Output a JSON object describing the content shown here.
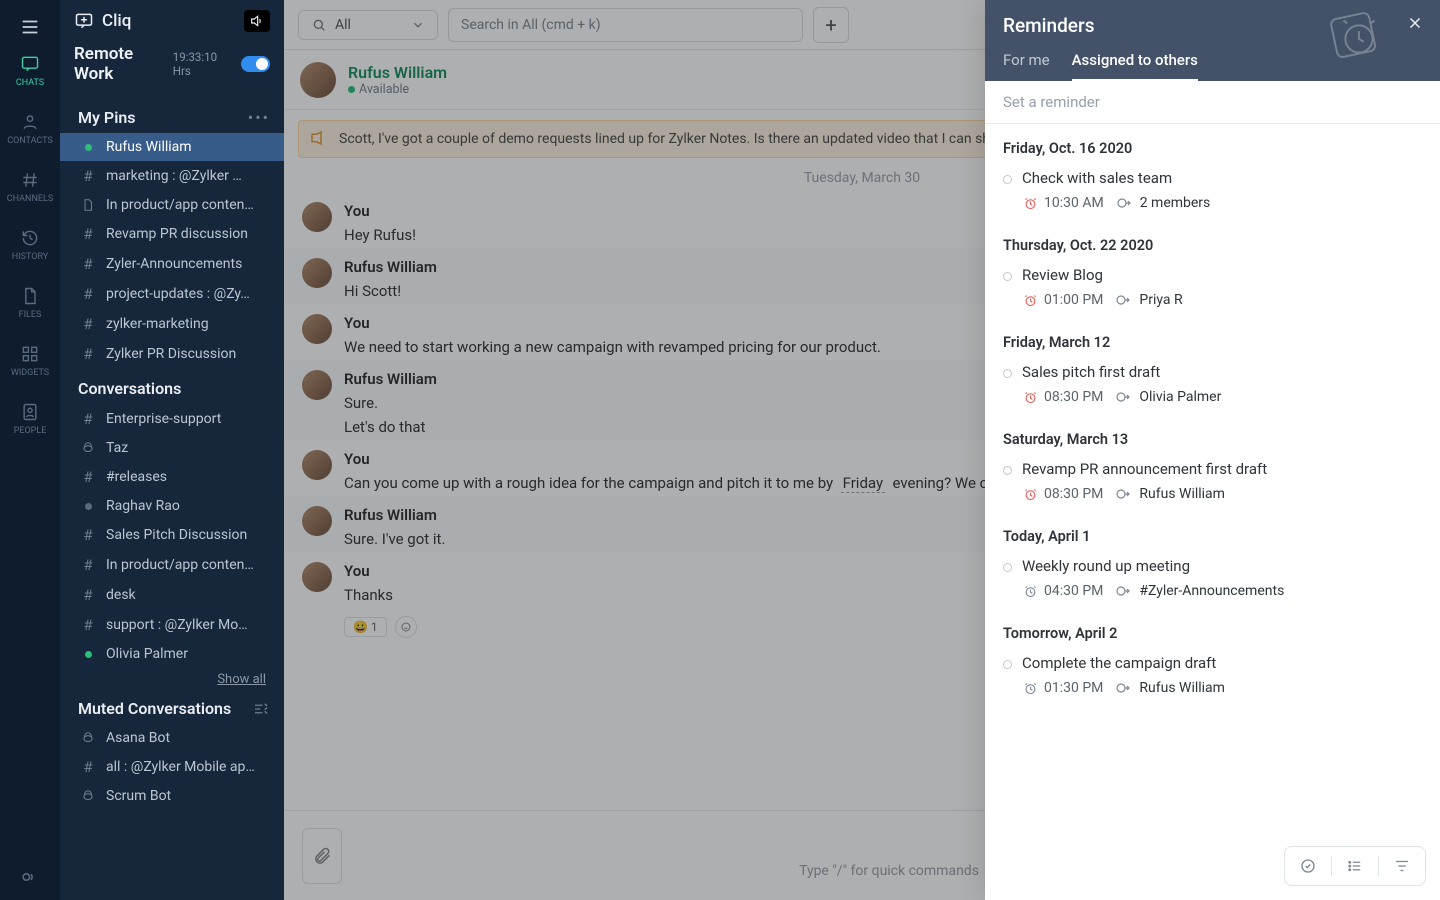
{
  "brand": "Cliq",
  "remote": {
    "title": "Remote Work",
    "hours": "19:33:10 Hrs"
  },
  "rail": {
    "chats": "Chats",
    "contacts": "Contacts",
    "channels": "Channels",
    "history": "History",
    "files": "Files",
    "widgets": "Widgets",
    "people": "People"
  },
  "pins": {
    "heading": "My Pins",
    "items": [
      {
        "icon": "dot-green",
        "label": "Rufus William",
        "active": true
      },
      {
        "icon": "hash",
        "label": "marketing : @Zylker …"
      },
      {
        "icon": "doc",
        "label": "In product/app conten…"
      },
      {
        "icon": "hash",
        "label": "Revamp PR discussion"
      },
      {
        "icon": "hash",
        "label": "Zyler-Announcements"
      },
      {
        "icon": "hash",
        "label": "project-updates : @Zy…"
      },
      {
        "icon": "hash",
        "label": "zylker-marketing"
      },
      {
        "icon": "hash",
        "label": "Zylker PR Discussion"
      }
    ]
  },
  "conversations": {
    "heading": "Conversations",
    "items": [
      {
        "icon": "hash",
        "label": "Enterprise-support"
      },
      {
        "icon": "bot",
        "label": "Taz"
      },
      {
        "icon": "hash",
        "label": "#releases"
      },
      {
        "icon": "dot-grey",
        "label": "Raghav Rao"
      },
      {
        "icon": "hash",
        "label": "Sales Pitch Discussion"
      },
      {
        "icon": "hash",
        "label": "In product/app conten…"
      },
      {
        "icon": "hash",
        "label": "desk"
      },
      {
        "icon": "hash",
        "label": "support : @Zylker Mo…"
      },
      {
        "icon": "dot-green",
        "label": "Olivia Palmer"
      }
    ],
    "show_all": "Show all"
  },
  "muted": {
    "heading": "Muted Conversations",
    "items": [
      {
        "icon": "bot",
        "label": "Asana Bot"
      },
      {
        "icon": "hash",
        "label": "all : @Zylker Mobile ap…"
      },
      {
        "icon": "bot",
        "label": "Scrum Bot"
      }
    ]
  },
  "search": {
    "scope": "All",
    "placeholder": "Search in All (cmd + k)"
  },
  "chat": {
    "name": "Rufus William",
    "status": "Available",
    "banner": "Scott, I've got a couple of demo requests lined up for Zylker Notes. Is there an updated video that I can share with",
    "date_chip": "Tuesday, March 30",
    "messages": [
      {
        "who": "You",
        "alt": false,
        "lines": [
          "Hey Rufus!"
        ]
      },
      {
        "who": "Rufus William",
        "alt": true,
        "lines": [
          "Hi Scott!"
        ]
      },
      {
        "who": "You",
        "alt": false,
        "lines": [
          "We need to start working a new campaign with revamped pricing for our product."
        ]
      },
      {
        "who": "Rufus William",
        "alt": true,
        "lines": [
          "Sure.",
          "Let's do that"
        ]
      },
      {
        "who": "You",
        "alt": false,
        "lines": [
          "Can you come up with a rough idea for the campaign and pitch it to me by  Friday  evening? We c"
        ],
        "has_friday": true
      },
      {
        "who": "Rufus William",
        "alt": true,
        "lines": [
          "Sure. I've got it."
        ]
      },
      {
        "who": "You",
        "alt": false,
        "lines": [
          "Thanks"
        ],
        "reaction": {
          "emoji": "😀",
          "count": "1"
        }
      }
    ],
    "compose_hint": "Type \"/\" for quick commands"
  },
  "panel": {
    "title": "Reminders",
    "tab_for_me": "For me",
    "tab_assigned": "Assigned to others",
    "input_placeholder": "Set a reminder",
    "groups": [
      {
        "date": "Friday, Oct. 16 2020",
        "items": [
          {
            "title": "Check with sales team",
            "time": "10:30 AM",
            "assignee": "2 members",
            "overdue": true
          }
        ]
      },
      {
        "date": "Thursday, Oct. 22 2020",
        "items": [
          {
            "title": "Review Blog",
            "time": "01:00 PM",
            "assignee": "Priya R",
            "overdue": true
          }
        ]
      },
      {
        "date": "Friday, March 12",
        "items": [
          {
            "title": "Sales pitch first draft",
            "time": "08:30 PM",
            "assignee": "Olivia Palmer",
            "overdue": true
          }
        ]
      },
      {
        "date": "Saturday, March 13",
        "items": [
          {
            "title": "Revamp PR announcement first draft",
            "time": "08:30 PM",
            "assignee": "Rufus William",
            "overdue": true
          }
        ]
      },
      {
        "date": "Today, April 1",
        "items": [
          {
            "title": "Weekly round up meeting",
            "time": "04:30 PM",
            "assignee": "#Zyler-Announcements",
            "overdue": false
          }
        ]
      },
      {
        "date": "Tomorrow, April 2",
        "items": [
          {
            "title": "Complete the campaign draft",
            "time": "01:30 PM",
            "assignee": "Rufus William",
            "overdue": false
          }
        ]
      }
    ]
  }
}
